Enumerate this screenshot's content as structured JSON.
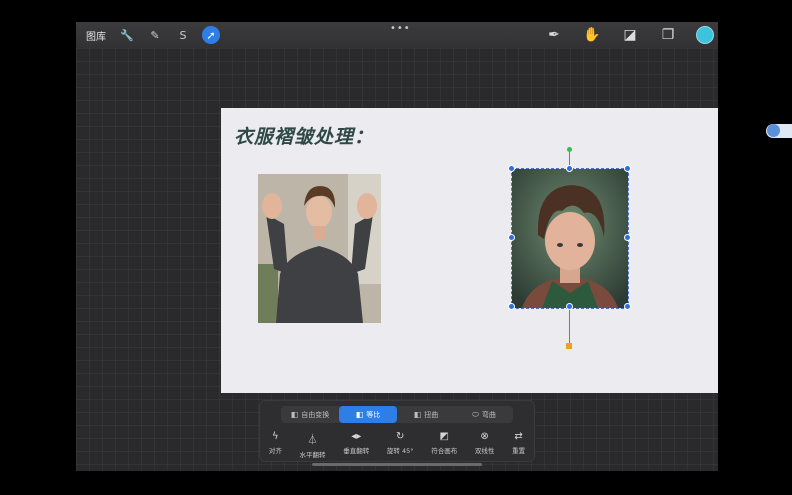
{
  "topbar": {
    "gallery_label": "图库",
    "left_tools": [
      {
        "icon": "wrench-icon",
        "glyph": "🔧"
      },
      {
        "icon": "magic-wand-icon",
        "glyph": "✎"
      },
      {
        "icon": "selection-s-icon",
        "glyph": "S"
      },
      {
        "icon": "transform-arrow-icon",
        "glyph": "➚"
      }
    ],
    "more_dots": "•••",
    "right_tools": [
      {
        "icon": "brush-icon",
        "glyph": "✒"
      },
      {
        "icon": "smudge-icon",
        "glyph": "✋"
      },
      {
        "icon": "eraser-icon",
        "glyph": "◪"
      },
      {
        "icon": "layers-icon",
        "glyph": "❐"
      }
    ],
    "current_color": "#3ec3dc"
  },
  "canvas": {
    "heading": "衣服褶皱处理："
  },
  "transform_toolbar": {
    "modes": [
      {
        "label": "自由变换",
        "icon": "◧",
        "active": false
      },
      {
        "label": "等比",
        "icon": "◧",
        "active": true
      },
      {
        "label": "扭曲",
        "icon": "◧",
        "active": false
      },
      {
        "label": "弯曲",
        "icon": "⬭",
        "active": false
      }
    ],
    "actions": [
      {
        "label": "对齐",
        "icon": "ϟ"
      },
      {
        "label": "水平翻转",
        "icon": "⏃"
      },
      {
        "label": "垂直翻转",
        "icon": "◂▸"
      },
      {
        "label": "旋转 45°",
        "icon": "↻"
      },
      {
        "label": "符合画布",
        "icon": "◩"
      },
      {
        "label": "双线性",
        "icon": "⊗"
      },
      {
        "label": "重置",
        "icon": "⇄"
      }
    ]
  },
  "accent_color": "#2f7ee8"
}
